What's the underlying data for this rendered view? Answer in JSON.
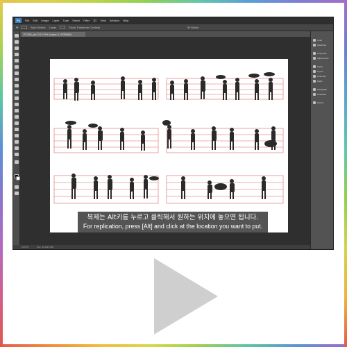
{
  "app": {
    "logo": "Ps"
  },
  "menu": {
    "items": [
      "File",
      "Edit",
      "Image",
      "Layer",
      "Type",
      "Select",
      "Filter",
      "3D",
      "View",
      "Window",
      "Help"
    ]
  },
  "options_bar": {
    "items": [
      "Auto-Select:",
      "Layer",
      "Show Transform Controls"
    ],
    "mode_label": "3D Mode:"
  },
  "document": {
    "tab_label": "P1230_prt CS 0.0% (Layer 0, RGB/8#)"
  },
  "panels": {
    "items": [
      "Color",
      "Swatches",
      "Properties",
      "Adjustments",
      "Styles",
      "Layers",
      "Channels",
      "Paths",
      "Paragraph",
      "Character",
      "History"
    ]
  },
  "status": {
    "zoom": "16.67%",
    "doc_size": "Doc: 34.1M/1.04G"
  },
  "subtitle": {
    "korean": "복제는 Alt키를 누르고 클릭해서 원하는 위치에 놓으면 됩니다.",
    "english": "For replication, press [Alt] and click at the location you want to put."
  },
  "player": {
    "play_icon": "play-icon",
    "play_color": "#cfcfcf"
  },
  "colors": {
    "workspace": "#3a3a3a",
    "canvas": "#ffffff",
    "figure_dark": "#2a2a2a",
    "guide_red": "#d44a4a"
  }
}
